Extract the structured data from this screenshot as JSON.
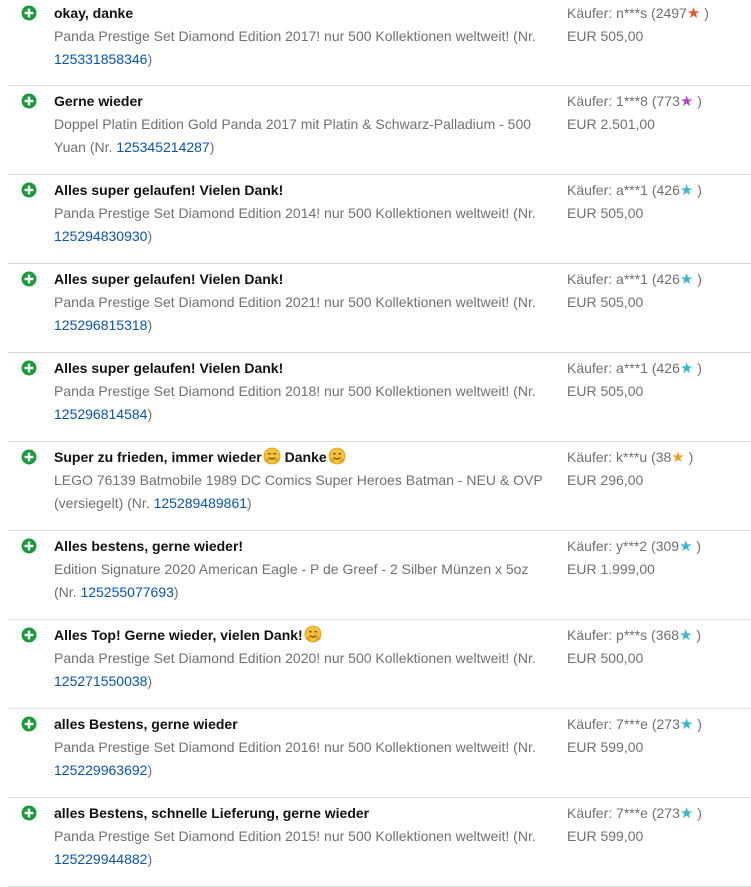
{
  "icons": {
    "positive": "plus-circle-icon",
    "emoji": "hugging-face-icon"
  },
  "colors": {
    "positive": "#1a9b3b",
    "link": "#0654ba",
    "muted": "#707070",
    "divider": "#dddddd"
  },
  "feedback": [
    {
      "comment": "okay, danke",
      "emoji_count": 0,
      "item": "Panda Prestige Set Diamond Edition 2017! nur 500 Kollektionen weltweit!",
      "item_no": "125331858346",
      "buyer": "Käufer: n***s (2497",
      "star_color": "#e0592a",
      "price": "EUR 505,00"
    },
    {
      "comment": "Gerne wieder",
      "emoji_count": 0,
      "item": "Doppel Platin Edition Gold Panda 2017 mit Platin & Schwarz-Palladium - 500 Yuan",
      "item_no": "125345214287",
      "buyer": "Käufer: 1***8 (773",
      "star_color": "#b545c9",
      "price": "EUR 2.501,00"
    },
    {
      "comment": "Alles super gelaufen! Vielen Dank!",
      "emoji_count": 0,
      "item": "Panda Prestige Set Diamond Edition 2014! nur 500 Kollektionen weltweit!",
      "item_no": "125294830930",
      "buyer": "Käufer: a***1 (426",
      "star_color": "#35b7d0",
      "price": "EUR 505,00"
    },
    {
      "comment": "Alles super gelaufen! Vielen Dank!",
      "emoji_count": 0,
      "item": "Panda Prestige Set Diamond Edition 2021! nur 500 Kollektionen weltweit!",
      "item_no": "125296815318",
      "buyer": "Käufer: a***1 (426",
      "star_color": "#35b7d0",
      "price": "EUR 505,00"
    },
    {
      "comment": "Alles super gelaufen! Vielen Dank!",
      "emoji_count": 0,
      "item": "Panda Prestige Set Diamond Edition 2018! nur 500 Kollektionen weltweit!",
      "item_no": "125296814584",
      "buyer": "Käufer: a***1 (426",
      "star_color": "#35b7d0",
      "price": "EUR 505,00"
    },
    {
      "comment": "Super zu frieden, immer wieder",
      "comment_after": "Danke",
      "emoji_count": 2,
      "item": "LEGO 76139 Batmobile 1989 DC Comics Super Heroes Batman - NEU & OVP (versiegelt)",
      "item_no": "125289489861",
      "buyer": "Käufer: k***u (38",
      "star_color": "#f0a020",
      "price": "EUR 296,00"
    },
    {
      "comment": "Alles bestens, gerne wieder!",
      "emoji_count": 0,
      "item": "Edition Signature 2020 American Eagle - P de Greef - 2 Silber Münzen x 5oz",
      "item_no": "125255077693",
      "buyer": "Käufer: y***2 (309",
      "star_color": "#35b7d0",
      "price": "EUR 1.999,00"
    },
    {
      "comment": "Alles Top! Gerne wieder, vielen Dank!",
      "emoji_count": 1,
      "item": "Panda Prestige Set Diamond Edition 2020! nur 500 Kollektionen weltweit!",
      "item_no": "125271550038",
      "buyer": "Käufer: p***s (368",
      "star_color": "#35b7d0",
      "price": "EUR 500,00"
    },
    {
      "comment": "alles Bestens, gerne wieder",
      "emoji_count": 0,
      "item": "Panda Prestige Set Diamond Edition 2016! nur 500 Kollektionen weltweit!",
      "item_no": "125229963692",
      "buyer": "Käufer: 7***e (273",
      "star_color": "#35b7d0",
      "price": "EUR 599,00"
    },
    {
      "comment": "alles Bestens, schnelle Lieferung, gerne wieder",
      "emoji_count": 0,
      "item": "Panda Prestige Set Diamond Edition 2015! nur 500 Kollektionen weltweit!",
      "item_no": "125229944882",
      "buyer": "Käufer: 7***e (273",
      "star_color": "#35b7d0",
      "price": "EUR 599,00"
    }
  ],
  "labels": {
    "item_no_prefix": "(Nr.",
    "item_no_suffix": ")",
    "star_glyph": "★",
    "buyer_suffix": ")"
  }
}
